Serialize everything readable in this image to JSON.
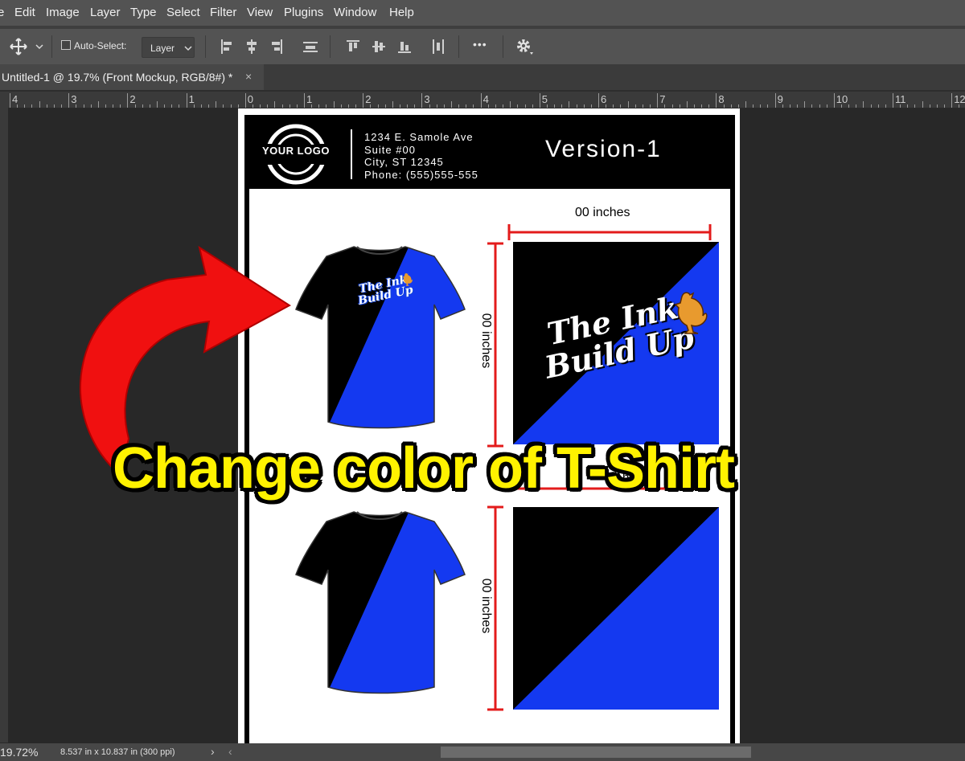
{
  "menu": {
    "items": [
      "e",
      "Edit",
      "Image",
      "Layer",
      "Type",
      "Select",
      "Filter",
      "View",
      "Plugins",
      "Window",
      "Help"
    ]
  },
  "options": {
    "auto_select_label": "Auto-Select:",
    "layer_select_value": "Layer",
    "more_label": "•••"
  },
  "document": {
    "tab_title": "Untitled-1 @ 19.7% (Front Mockup, RGB/8#) *",
    "close_glyph": "×"
  },
  "ruler": {
    "labels": [
      "4",
      "3",
      "2",
      "1",
      "0",
      "1",
      "2",
      "3",
      "4",
      "5",
      "6",
      "7",
      "8",
      "9",
      "10",
      "11",
      "12"
    ]
  },
  "mockup": {
    "logo_text": "YOUR LOGO",
    "address": [
      "1234 E. Samole Ave",
      "Suite #00",
      "City, ST 12345",
      "Phone: (555)555-555"
    ],
    "version": "Version-1",
    "dim_top": "00 inches",
    "dim_side_1": "00 inches",
    "dim_mid_partial": "hes",
    "dim_side_2": "00 inches",
    "design_line1": "The Ink",
    "design_line2": "Build Up",
    "colors": {
      "blue": "#1439f0",
      "black": "#000000",
      "dim_red": "#e31b1b",
      "rooster": "#e89a2e"
    }
  },
  "overlay": {
    "caption": "Change color of T-Shirt",
    "caption_color": "#fff200",
    "arrow_color": "#f01010"
  },
  "status": {
    "zoom": "19.72%",
    "doc_size": "8.537 in x 10.837 in (300 ppi)",
    "arrow_right": "›",
    "arrow_left": "‹"
  }
}
